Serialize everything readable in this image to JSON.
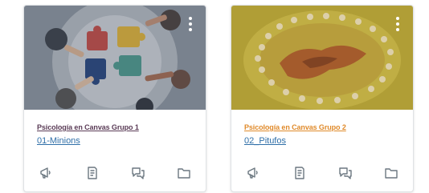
{
  "cards": [
    {
      "course_name": "Psicología en Canvas Grupo 1",
      "course_code": "01-Minions",
      "name_color": "#5a3b56",
      "code_color": "#2f6fa8",
      "icons": [
        "announcements-icon",
        "assignments-icon",
        "discussions-icon",
        "files-icon"
      ]
    },
    {
      "course_name": "Psicología en Canvas Grupo 2",
      "course_code": "02_Pitufos",
      "name_color": "#e08a2a",
      "code_color": "#2f6fa8",
      "icons": [
        "announcements-icon",
        "assignments-icon",
        "discussions-icon",
        "files-icon"
      ]
    }
  ],
  "colors": {
    "card_border": "#dfe2e5",
    "icon_gray": "#6b7780"
  }
}
